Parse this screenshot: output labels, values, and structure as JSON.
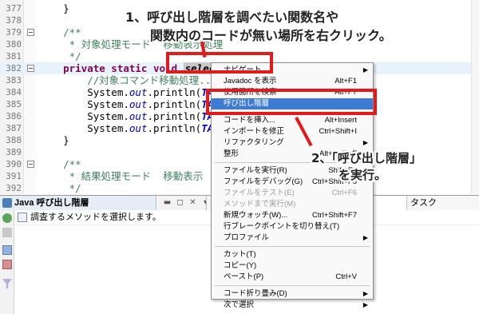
{
  "editor": {
    "lines": [
      {
        "num": "377",
        "text": "    }"
      },
      {
        "num": "378",
        "text": ""
      },
      {
        "num": "379",
        "text": "    /**"
      },
      {
        "num": "380",
        "text": "     * 対象処理モード  移動表示処理"
      },
      {
        "num": "381",
        "text": "     */"
      },
      {
        "num": "382",
        "kw": "    private static void ",
        "selected": "selectMove",
        "rest": "() {"
      },
      {
        "num": "383",
        "text": "        //対象コマンド移動処理..."
      },
      {
        "num": "384",
        "prefix": "        System.",
        "field": "out",
        "mid": ".println(",
        "const": "TAR_U",
        "rest": ""
      },
      {
        "num": "385",
        "prefix": "        System.",
        "field": "out",
        "mid": ".println(",
        "const": "TAR_L",
        "rest": ""
      },
      {
        "num": "386",
        "prefix": "        System.",
        "field": "out",
        "mid": ".println(",
        "const": "TAR_D",
        "rest": ""
      },
      {
        "num": "387",
        "prefix": "        System.",
        "field": "out",
        "mid": ".println(",
        "const": "TAR_R",
        "rest": ""
      },
      {
        "num": "388",
        "text": "    }"
      },
      {
        "num": "389",
        "text": ""
      },
      {
        "num": "390",
        "text": "    /**"
      },
      {
        "num": "391",
        "text": "     * 結果処理モード  移動表示"
      },
      {
        "num": "392",
        "text": "     */"
      }
    ]
  },
  "bottom_panel": {
    "call_hierarchy_tab": "Java 呼び出し階層",
    "status_message": "調査するメソッドを選択します。",
    "other_tab_1": "出",
    "other_tab_2": "タスク"
  },
  "context_menu": {
    "items": [
      {
        "label": "ナビゲート",
        "accel": "",
        "submenu": true,
        "disabled": false,
        "active": false
      },
      {
        "label": "Javadoc を表示",
        "accel": "Alt+F1",
        "submenu": false,
        "disabled": false,
        "active": false
      },
      {
        "label": "使用箇所を検索",
        "accel": "Alt+F7",
        "submenu": false,
        "disabled": false,
        "active": false
      },
      {
        "label": "呼び出し階層",
        "accel": "",
        "submenu": false,
        "disabled": false,
        "active": true
      },
      {
        "label": "",
        "accel": "",
        "separator": true
      },
      {
        "label": "コードを挿入...",
        "accel": "Alt+Insert",
        "submenu": false,
        "disabled": false,
        "active": false
      },
      {
        "label": "インポートを修正",
        "accel": "Ctrl+Shift+I",
        "submenu": false,
        "disabled": false,
        "active": false
      },
      {
        "label": "リファクタリング",
        "accel": "",
        "submenu": true,
        "disabled": false,
        "active": false
      },
      {
        "label": "整形",
        "accel": "Alt+Shift+F",
        "submenu": false,
        "disabled": false,
        "active": false
      },
      {
        "label": "",
        "accel": "",
        "separator": true
      },
      {
        "label": "ファイルを実行(R)",
        "accel": "Shift+F6",
        "submenu": false,
        "disabled": false,
        "active": false
      },
      {
        "label": "ファイルをデバッグ(G)",
        "accel": "Ctrl+Shift+F5",
        "submenu": false,
        "disabled": false,
        "active": false
      },
      {
        "label": "ファイルをテスト(E)",
        "accel": "Ctrl+F6",
        "submenu": false,
        "disabled": true,
        "active": false
      },
      {
        "label": "メソッドまで実行(M)",
        "accel": "",
        "submenu": false,
        "disabled": true,
        "active": false
      },
      {
        "label": "新規ウォッチ(W)...",
        "accel": "Ctrl+Shift+F7",
        "submenu": false,
        "disabled": false,
        "active": false
      },
      {
        "label": "行ブレークポイントを切り替え(T)",
        "accel": "",
        "submenu": false,
        "disabled": false,
        "active": false
      },
      {
        "label": "プロファイル",
        "accel": "",
        "submenu": true,
        "disabled": false,
        "active": false
      },
      {
        "label": "",
        "accel": "",
        "separator": true
      },
      {
        "label": "カット(T)",
        "accel": "",
        "submenu": false,
        "disabled": false,
        "active": false
      },
      {
        "label": "コピー(Y)",
        "accel": "",
        "submenu": false,
        "disabled": false,
        "active": false
      },
      {
        "label": "ペースト(P)",
        "accel": "Ctrl+V",
        "submenu": false,
        "disabled": false,
        "active": false
      },
      {
        "label": "",
        "accel": "",
        "separator": true
      },
      {
        "label": "コード折り畳み(D)",
        "accel": "",
        "submenu": true,
        "disabled": false,
        "active": false
      },
      {
        "label": "次で選択",
        "accel": "",
        "submenu": true,
        "disabled": false,
        "active": false
      }
    ]
  },
  "annotations": {
    "step1_line1": "1、呼び出し階層を調べたい関数名や",
    "step1_line2": "関数内のコードが無い場所を右クリック。",
    "step2_line1": "2、「呼び出し階層」",
    "step2_line2": "を実行。"
  },
  "colors": {
    "annotation_red": "#e21a1a",
    "menu_highlight": "#3d7bd6",
    "keyword": "#7f0055",
    "comment": "#3f7f5f"
  }
}
